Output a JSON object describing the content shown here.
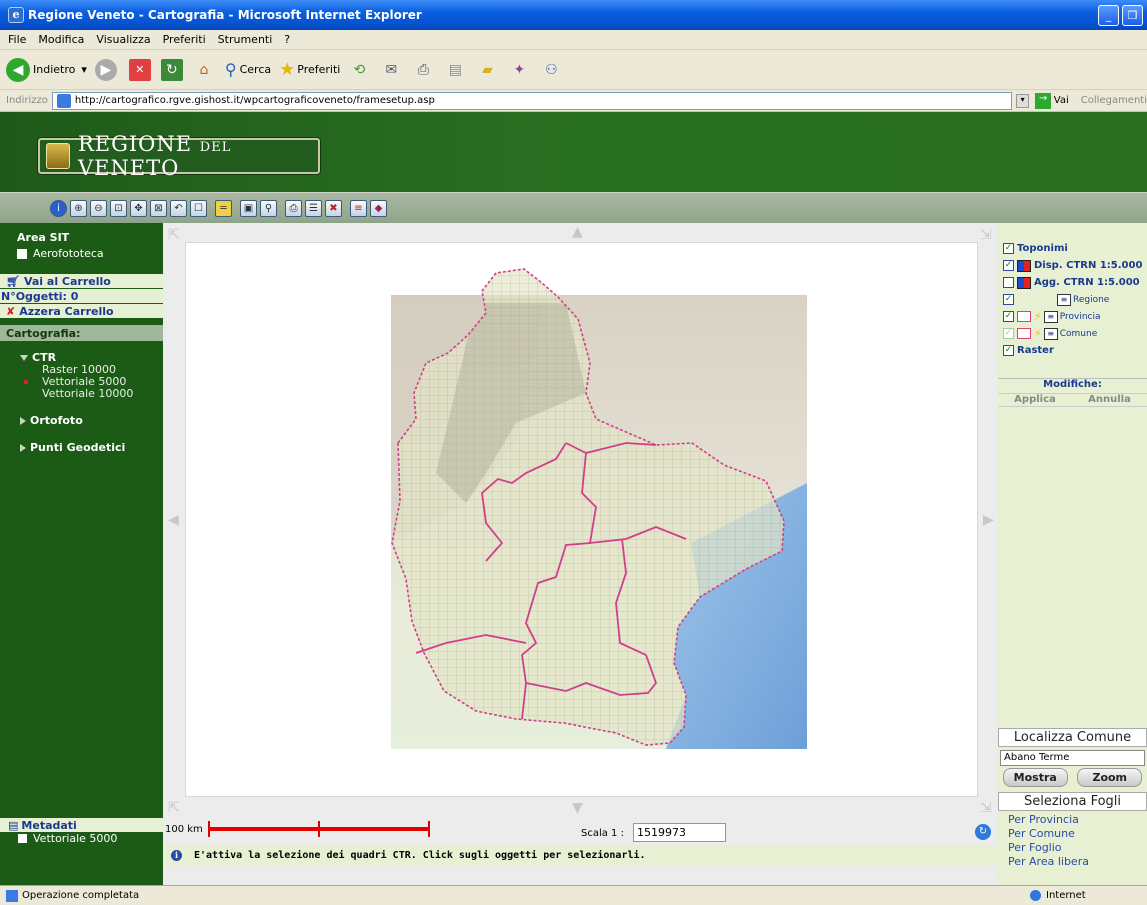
{
  "window": {
    "title": "Regione Veneto - Cartografia - Microsoft Internet Explorer"
  },
  "menu": [
    "File",
    "Modifica",
    "Visualizza",
    "Preferiti",
    "Strumenti",
    "?"
  ],
  "toolbar": {
    "back": "Indietro",
    "search": "Cerca",
    "favorites": "Preferiti"
  },
  "address": {
    "label": "Indirizzo",
    "url": "http://cartografico.rgve.gishost.it/wpcartograficoveneto/framesetup.asp",
    "go": "Vai",
    "links": "Collegamenti"
  },
  "header": {
    "logo_part1": "REGIONE",
    "logo_part2": "DEL",
    "logo_part3": "VENETO"
  },
  "left": {
    "area_sit": "Area SIT",
    "aerofototeca": "Aerofototeca",
    "vai_carrello": "Vai al Carrello",
    "n_oggetti": "N°Oggetti: 0",
    "azzera": "Azzera Carrello",
    "cartografia": "Cartografia:",
    "ctr": "CTR",
    "ctr_items": [
      "Raster 10000",
      "Vettoriale 5000",
      "Vettoriale 10000"
    ],
    "ortofoto": "Ortofoto",
    "punti": "Punti Geodetici",
    "metadati": "Metadati",
    "metadati_item": "Vettoriale 5000"
  },
  "map": {
    "scale_label": "100 km",
    "scala_label": "Scala  1 :",
    "scala_value": "1519973",
    "info": "E'attiva la selezione dei quadri CTR. Click sugli oggetti per selezionarli."
  },
  "right": {
    "layers": [
      {
        "label": "Toponimi",
        "checked": true
      },
      {
        "label": "Disp. CTRN 1:5.000",
        "checked": true
      },
      {
        "label": "Agg. CTRN 1:5.000",
        "checked": false
      },
      {
        "label": "Regione",
        "checked": true
      },
      {
        "label": "Provincia",
        "checked": true
      },
      {
        "label": "Comune",
        "checked": true
      },
      {
        "label": "Raster",
        "checked": true
      }
    ],
    "modifiche": "Modifiche:",
    "applica": "Applica",
    "annulla": "Annulla",
    "localizza": "Localizza Comune",
    "comune_value": "Abano Terme",
    "mostra": "Mostra",
    "zoom": "Zoom",
    "seleziona": "Seleziona Fogli",
    "options": [
      "Per Provincia",
      "Per Comune",
      "Per Foglio",
      "Per Area libera"
    ]
  },
  "status": {
    "left": "Operazione completata",
    "zone": "Internet"
  },
  "colors": {
    "header_green": "#2a7022",
    "panel_light": "#e7f0d2",
    "boundary": "#d0408a"
  }
}
